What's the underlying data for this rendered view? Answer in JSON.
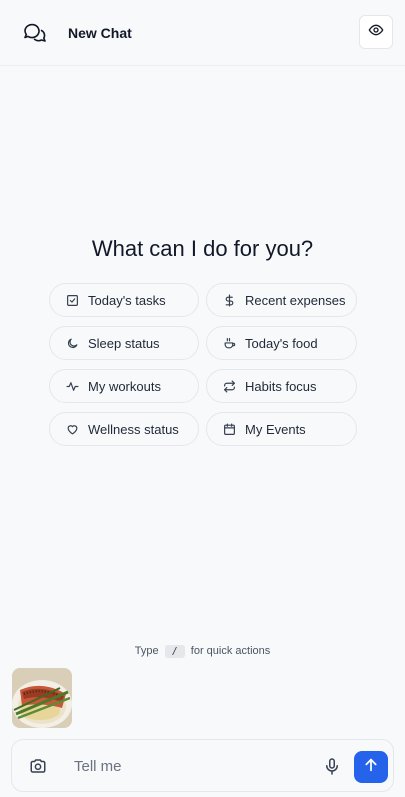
{
  "header": {
    "title": "New Chat",
    "chat_icon": "chat-bubbles-icon",
    "visibility_icon": "eye-icon"
  },
  "main": {
    "heading": "What can I do for you?",
    "quick_actions": [
      {
        "label": "Today's tasks",
        "icon": "checkbox-icon"
      },
      {
        "label": "Recent expenses",
        "icon": "dollar-icon"
      },
      {
        "label": "Sleep status",
        "icon": "moon-icon"
      },
      {
        "label": "Today's food",
        "icon": "food-icon"
      },
      {
        "label": "My workouts",
        "icon": "activity-icon"
      },
      {
        "label": "Habits focus",
        "icon": "repeat-icon"
      },
      {
        "label": "Wellness status",
        "icon": "heart-icon"
      },
      {
        "label": "My Events",
        "icon": "calendar-icon"
      }
    ]
  },
  "hint": {
    "prefix": "Type",
    "key": "/",
    "suffix": "for quick actions"
  },
  "attachment": {
    "icon": "salmon-photo-thumbnail"
  },
  "composer": {
    "placeholder": "Tell me",
    "camera_icon": "camera-icon",
    "mic_icon": "microphone-icon",
    "send_icon": "arrow-up-icon"
  },
  "colors": {
    "background": "#f8f9fb",
    "accent": "#2563eb",
    "border": "#e4e7ec"
  }
}
